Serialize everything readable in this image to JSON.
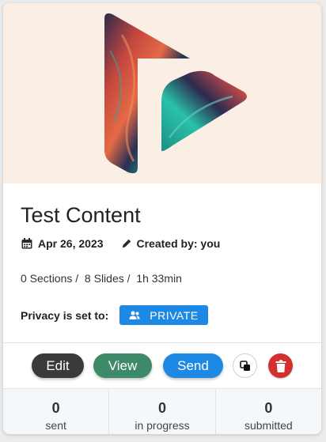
{
  "thumbnail": {
    "icon": "play-logo-icon",
    "background": "#fbeee5"
  },
  "content": {
    "title": "Test Content",
    "date": "Apr 26, 2023",
    "created_by": "Created by: you",
    "stats": "0 Sections /  8 Slides /  1h 33min"
  },
  "privacy": {
    "label": "Privacy is set to:",
    "value": "PRIVATE",
    "color": "#1e88e5"
  },
  "actions": {
    "edit_label": "Edit",
    "view_label": "View",
    "send_label": "Send",
    "copy_icon": "copy-icon",
    "delete_icon": "trash-icon",
    "colors": {
      "edit": "#3a3a3a",
      "view": "#3d8a69",
      "send": "#1e88e5",
      "delete": "#d32f2f"
    }
  },
  "footer": [
    {
      "count": "0",
      "label": "sent"
    },
    {
      "count": "0",
      "label": "in progress"
    },
    {
      "count": "0",
      "label": "submitted"
    }
  ]
}
